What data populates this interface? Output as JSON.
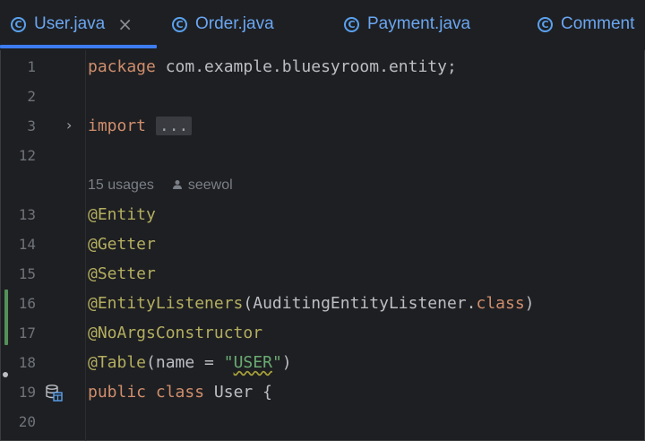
{
  "tabs": [
    {
      "label": "User.java",
      "active": true,
      "close": "×"
    },
    {
      "label": "Order.java",
      "active": false
    },
    {
      "label": "Payment.java",
      "active": false
    },
    {
      "label": "Comment",
      "active": false
    }
  ],
  "tab_icon_letter": "C",
  "editor": {
    "line_numbers": [
      "1",
      "2",
      "3",
      "12",
      "13",
      "14",
      "15",
      "16",
      "17",
      "18",
      "19",
      "20"
    ],
    "package_kw": "package",
    "package_name": " com.example.bluesyroom.entity;",
    "import_kw": "import",
    "import_fold": "...",
    "usages": "15 usages",
    "author": "seewol",
    "ann_entity": "@Entity",
    "ann_getter": "@Getter",
    "ann_setter": "@Setter",
    "ann_listeners": "@EntityListeners",
    "listeners_arg_open": "(AuditingEntityListener.",
    "listeners_class_kw": "class",
    "listeners_arg_close": ")",
    "ann_noargs": "@NoArgsConstructor",
    "ann_table": "@Table",
    "table_args_pre": "(name = ",
    "table_string_quote_open": "\"",
    "table_string_value": "USER",
    "table_string_quote_close": "\"",
    "table_args_post": ")",
    "class_kw_public": "public",
    "class_kw_class": "class",
    "class_decl": " User {"
  },
  "colors": {
    "accent": "#3d7cf0",
    "keyword": "#cf8e6d",
    "annotation": "#b3ae60",
    "string": "#6aab73",
    "change_bar": "#549159"
  }
}
